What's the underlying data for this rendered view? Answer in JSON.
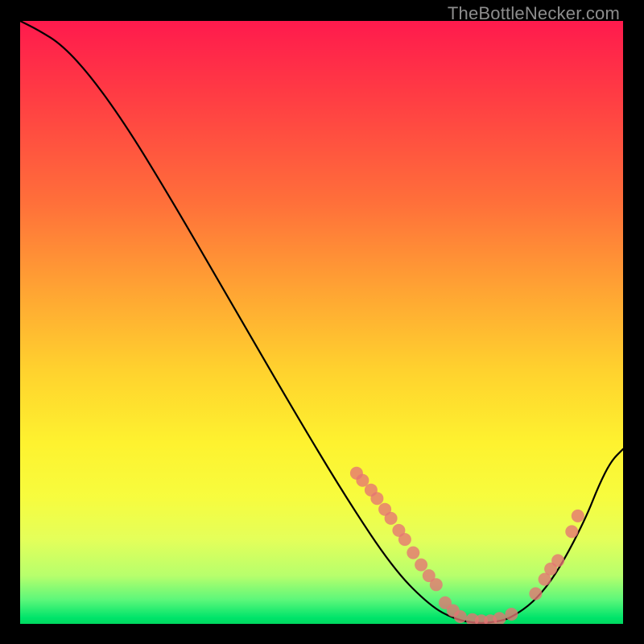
{
  "watermark": "TheBottleNecker.com",
  "chart_data": {
    "type": "line",
    "title": "",
    "xlabel": "",
    "ylabel": "",
    "xlim": [
      0,
      100
    ],
    "ylim": [
      0,
      100
    ],
    "grid": false,
    "series": [
      {
        "name": "curve",
        "points": [
          {
            "x": 0.0,
            "y": 100.0
          },
          {
            "x": 3.0,
            "y": 98.5
          },
          {
            "x": 7.0,
            "y": 96.0
          },
          {
            "x": 12.0,
            "y": 90.5
          },
          {
            "x": 18.0,
            "y": 82.0
          },
          {
            "x": 25.0,
            "y": 70.5
          },
          {
            "x": 34.0,
            "y": 55.0
          },
          {
            "x": 45.0,
            "y": 36.0
          },
          {
            "x": 54.0,
            "y": 21.0
          },
          {
            "x": 62.0,
            "y": 9.0
          },
          {
            "x": 68.0,
            "y": 3.0
          },
          {
            "x": 72.0,
            "y": 0.8
          },
          {
            "x": 76.0,
            "y": 0.0
          },
          {
            "x": 80.0,
            "y": 0.5
          },
          {
            "x": 82.0,
            "y": 1.4
          },
          {
            "x": 85.0,
            "y": 3.5
          },
          {
            "x": 88.0,
            "y": 7.0
          },
          {
            "x": 91.0,
            "y": 12.0
          },
          {
            "x": 94.0,
            "y": 18.0
          },
          {
            "x": 96.0,
            "y": 23.0
          },
          {
            "x": 98.0,
            "y": 27.0
          },
          {
            "x": 100.0,
            "y": 29.0
          }
        ]
      }
    ],
    "markers": [
      {
        "x": 55.8,
        "y": 25.0
      },
      {
        "x": 56.8,
        "y": 23.8
      },
      {
        "x": 58.2,
        "y": 22.2
      },
      {
        "x": 59.2,
        "y": 20.8
      },
      {
        "x": 60.5,
        "y": 19.0
      },
      {
        "x": 61.5,
        "y": 17.5
      },
      {
        "x": 62.8,
        "y": 15.5
      },
      {
        "x": 63.8,
        "y": 14.0
      },
      {
        "x": 65.2,
        "y": 11.8
      },
      {
        "x": 66.5,
        "y": 9.8
      },
      {
        "x": 67.8,
        "y": 8.0
      },
      {
        "x": 69.0,
        "y": 6.5
      },
      {
        "x": 70.5,
        "y": 3.5
      },
      {
        "x": 71.8,
        "y": 2.2
      },
      {
        "x": 73.0,
        "y": 1.2
      },
      {
        "x": 75.0,
        "y": 0.7
      },
      {
        "x": 76.5,
        "y": 0.5
      },
      {
        "x": 78.0,
        "y": 0.5
      },
      {
        "x": 79.5,
        "y": 0.9
      },
      {
        "x": 81.5,
        "y": 1.6
      },
      {
        "x": 85.5,
        "y": 5.0
      },
      {
        "x": 87.0,
        "y": 7.4
      },
      {
        "x": 88.0,
        "y": 9.1
      },
      {
        "x": 89.2,
        "y": 10.5
      },
      {
        "x": 91.5,
        "y": 15.3
      },
      {
        "x": 92.5,
        "y": 17.9
      }
    ],
    "marker_radius_px": 8
  }
}
